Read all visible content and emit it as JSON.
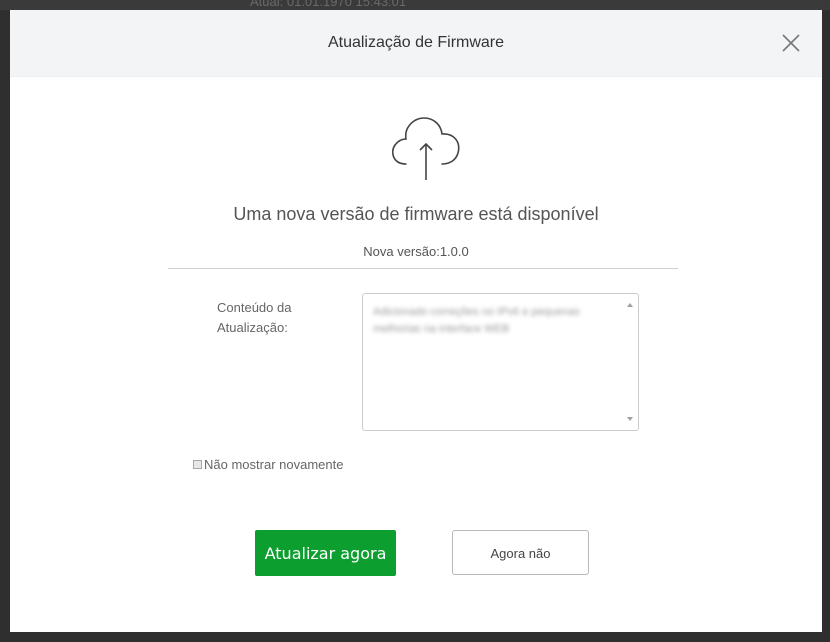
{
  "backdrop": {
    "text": "Atual:      01.01.1970 15:43:01"
  },
  "dialog": {
    "title": "Atualização de Firmware",
    "close_icon": "close-icon",
    "upload_icon": "cloud-upload-icon",
    "headline": "Uma nova versão de firmware está disponível",
    "version_text": "Nova versão:1.0.0",
    "content_label": "Conteúdo da Atualização:",
    "notes_text": "Adicionado correções no IPv6 e pequenas melhorias na interface WEB",
    "dont_show_label": "Não mostrar novamente",
    "dont_show_checked": false,
    "update_button": "Atualizar agora",
    "later_button": "Agora não"
  },
  "colors": {
    "primary_button": "#0c9e2f",
    "header_bg": "#f3f4f6"
  }
}
